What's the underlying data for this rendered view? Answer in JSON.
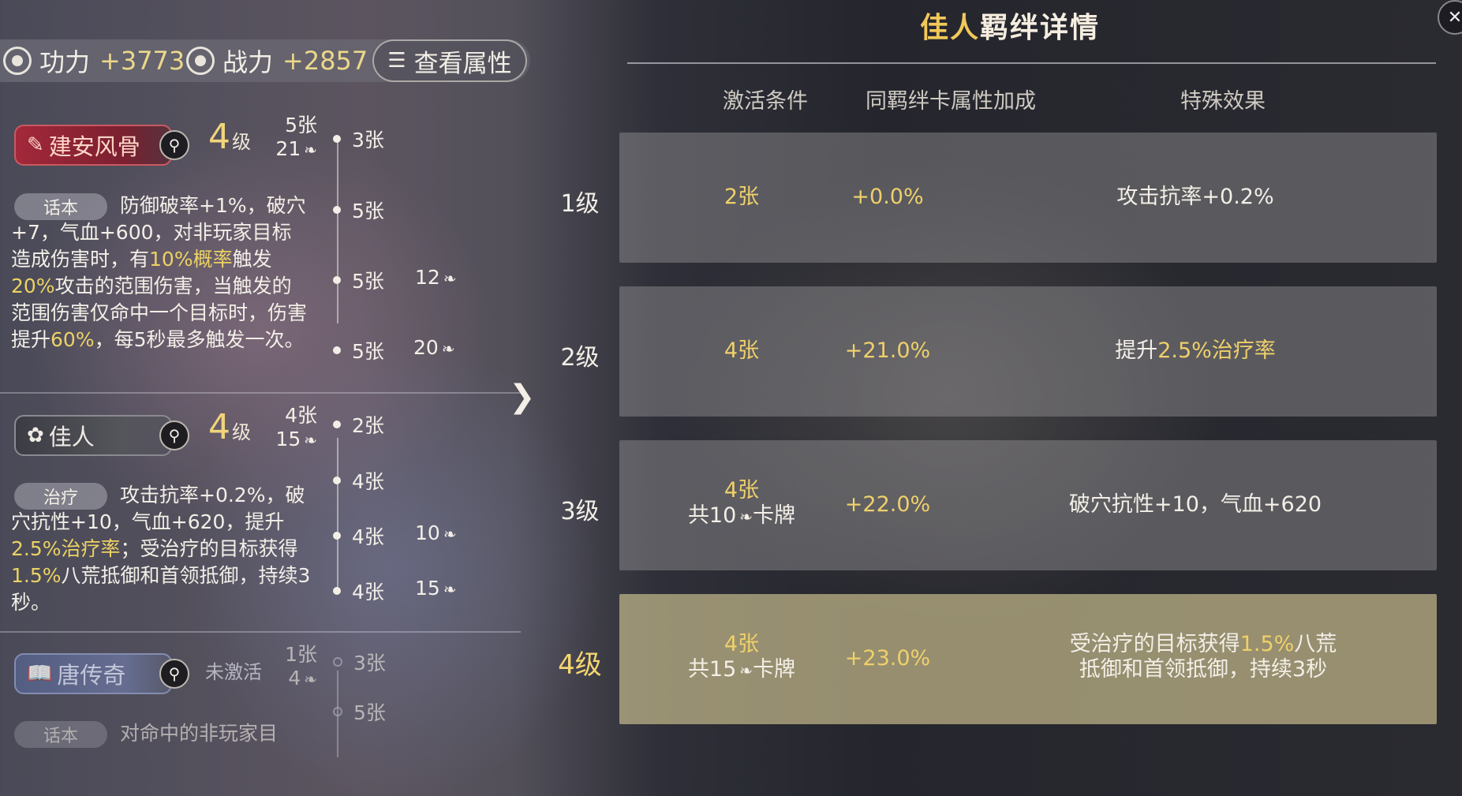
{
  "stats": {
    "gongli_label": "功力",
    "gongli_value": "+3773",
    "zhanli_label": "战力",
    "zhanli_value": "+2857",
    "view_attr_label": "查看属性"
  },
  "bonds": [
    {
      "name": "建安风骨",
      "level_num": "4",
      "level_unit": "级",
      "cards_count": "5张",
      "leaf_count": "21",
      "pill": "话本",
      "desc_parts": [
        "防御破率+1%，破穴+7，气血+600，对非玩家目标造成伤害时，有",
        "10%概率",
        "触发",
        "20%",
        "攻击的范围伤害，当触发的范围伤害仅命中一个目标时，伤害提升",
        "60%",
        "，每5秒最多触发一次。"
      ],
      "timeline": [
        {
          "cards": "3张",
          "extra": ""
        },
        {
          "cards": "5张",
          "extra": ""
        },
        {
          "cards": "5张",
          "extra": "12"
        },
        {
          "cards": "5张",
          "extra": "20"
        }
      ]
    },
    {
      "name": "佳人",
      "level_num": "4",
      "level_unit": "级",
      "cards_count": "4张",
      "leaf_count": "15",
      "pill": "治疗",
      "desc_parts": [
        "攻击抗率+0.2%，破穴抗性+10，气血+620，提升",
        "2.5%治疗率",
        "；受治疗的目标获得",
        "1.5%",
        "八荒抵御和首领抵御，持续3秒。"
      ],
      "timeline": [
        {
          "cards": "2张",
          "extra": ""
        },
        {
          "cards": "4张",
          "extra": ""
        },
        {
          "cards": "4张",
          "extra": "10"
        },
        {
          "cards": "4张",
          "extra": "15"
        }
      ]
    },
    {
      "name": "唐传奇",
      "status": "未激活",
      "cards_count": "1张",
      "leaf_count": "4",
      "pill": "话本",
      "desc": "对命中的非玩家目",
      "timeline": [
        {
          "cards": "3张"
        },
        {
          "cards": "5张"
        }
      ]
    }
  ],
  "detail": {
    "title_part1": "佳人",
    "title_part2": "羁绊详情",
    "col_condition": "激活条件",
    "col_bonus": "同羁绊卡属性加成",
    "col_effect": "特殊效果",
    "rows": [
      {
        "level": "1级",
        "cond1": "2张",
        "cond2": "",
        "bonus": "+0.0%",
        "effect_pre": "攻击抗率+0.2%",
        "effect_hl": "",
        "effect_post": "",
        "active": false
      },
      {
        "level": "2级",
        "cond1": "4张",
        "cond2": "",
        "bonus": "+21.0%",
        "effect_pre": "提升",
        "effect_hl": "2.5%治疗率",
        "effect_post": "",
        "active": false
      },
      {
        "level": "3级",
        "cond1": "4张",
        "cond2_pre": "共10",
        "cond2_post": "卡牌",
        "bonus": "+22.0%",
        "effect_pre": "破穴抗性+10，气血+620",
        "effect_hl": "",
        "effect_post": "",
        "active": false
      },
      {
        "level": "4级",
        "cond1": "4张",
        "cond2_pre": "共15",
        "cond2_post": "卡牌",
        "bonus": "+23.0%",
        "effect_pre": "受治疗的目标获得",
        "effect_hl": "1.5%",
        "effect_post": "八荒抵御和首领抵御，持续3秒",
        "active": true
      }
    ]
  }
}
